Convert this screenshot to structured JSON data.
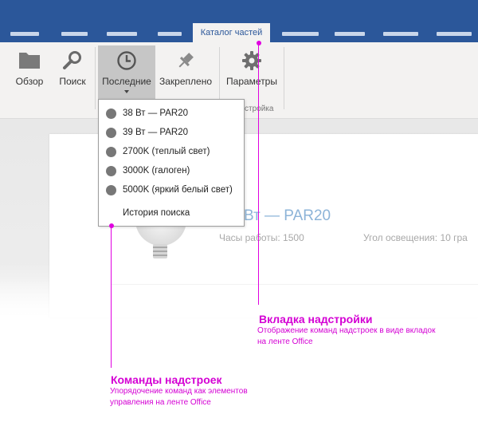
{
  "tabs": {
    "active_label": "Каталог частей"
  },
  "ribbon": {
    "buttons": [
      {
        "label": "Обзор",
        "icon": "folder-icon"
      },
      {
        "label": "Поиск",
        "icon": "search-icon"
      },
      {
        "label": "Последние",
        "icon": "clock-icon"
      },
      {
        "label": "Закреплено",
        "icon": "pin-icon"
      },
      {
        "label": "Параметры",
        "icon": "gear-icon"
      }
    ],
    "group_label_partial": "стройка"
  },
  "dropdown": {
    "items": [
      {
        "label": "38 Вт — PAR20"
      },
      {
        "label": "39 Вт — PAR20"
      },
      {
        "label": "2700K (теплый свет)"
      },
      {
        "label": "3000K (галоген)"
      },
      {
        "label": "5000K (яркий белый свет)"
      }
    ],
    "history_label": "История поиска"
  },
  "document": {
    "part_title": "Вт — PAR20",
    "hours_label": "Часы работы: 1500",
    "angle_label": "Угол освещения: 10 гра"
  },
  "callouts": {
    "addin_tab": {
      "title": "Вкладка надстройки",
      "desc_line1": "Отображение команд надстроек в виде вкладок",
      "desc_line2": "на ленте Office"
    },
    "addin_commands": {
      "title": "Команды надстроек",
      "desc_line1": "Упорядочение команд как элементов",
      "desc_line2": "управления на ленте Office"
    }
  },
  "colors": {
    "ribbon_blue": "#2b579a",
    "callout_magenta": "#e000e0"
  }
}
